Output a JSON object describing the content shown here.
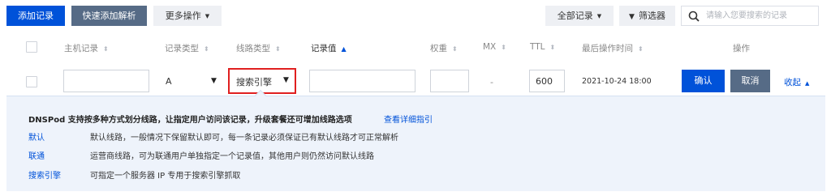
{
  "toolbar": {
    "add_record": "添加记录",
    "quick_add": "快速添加解析",
    "more_actions": "更多操作",
    "all_records": "全部记录",
    "filter": "筛选器",
    "search_placeholder": "请输入您要搜索的记录"
  },
  "table_header": {
    "host": "主机记录",
    "type": "记录类型",
    "line": "线路类型",
    "value": "记录值",
    "weight": "权重",
    "mx": "MX",
    "ttl": "TTL",
    "last_op": "最后操作时间",
    "actions": "操作"
  },
  "edit_row": {
    "host_value": "",
    "type_value": "A",
    "line_value": "搜索引擎",
    "record_value": "",
    "weight_value": "",
    "mx_value": "-",
    "ttl_value": "600",
    "last_op_time": "2021-10-24 18:00",
    "confirm": "确认",
    "cancel": "取消",
    "collapse": "收起"
  },
  "info_panel": {
    "title": "DNSPod 支持按多种方式划分线路，让指定用户访问该记录，升级套餐还可增加线路选项",
    "detail_link": "查看详细指引",
    "lines": [
      {
        "name": "默认",
        "desc": "默认线路，一般情况下保留默认即可，每一条记录必须保证已有默认线路才可正常解析"
      },
      {
        "name": "联通",
        "desc": "运营商线路，可为联通用户单独指定一个记录值，其他用户则仍然访问默认线路"
      },
      {
        "name": "搜索引擎",
        "desc": "可指定一个服务器 IP 专用于搜索引擎抓取"
      }
    ]
  },
  "colors": {
    "primary": "#0052d9",
    "dark_button": "#566b86",
    "highlight": "#e02020",
    "panel_bg": "#eef3fb"
  }
}
